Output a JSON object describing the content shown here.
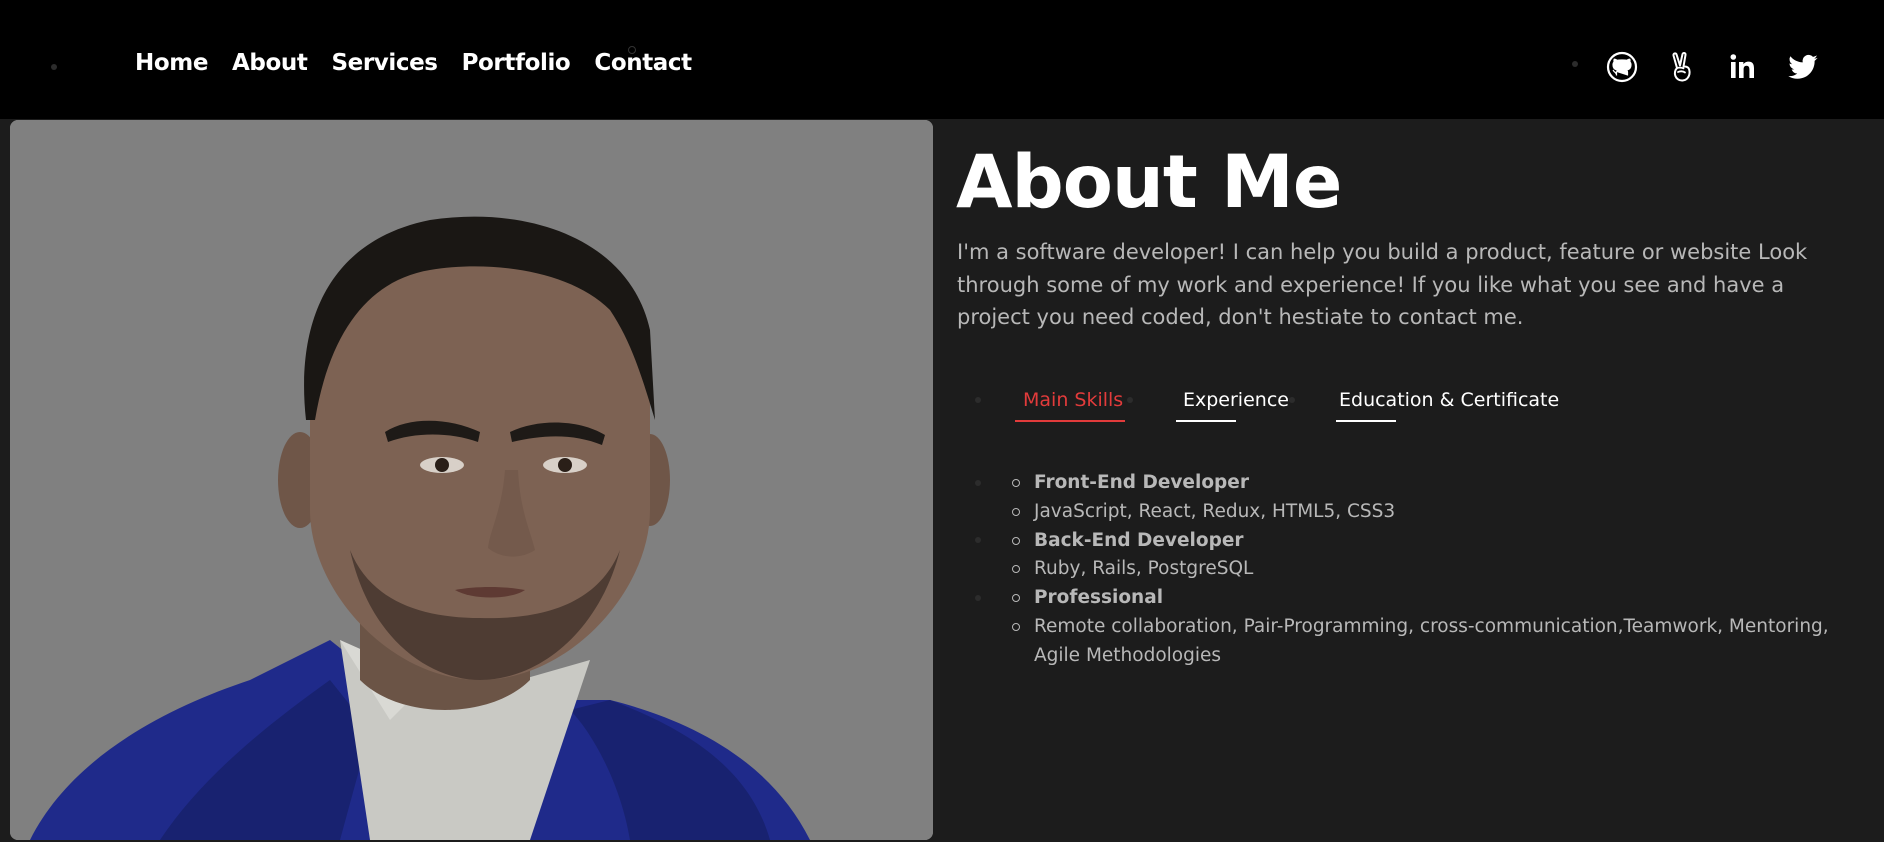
{
  "nav": {
    "links": [
      "Home",
      "About",
      "Services",
      "Portfolio",
      "Contact"
    ]
  },
  "social": [
    {
      "icon": "github-icon"
    },
    {
      "icon": "peace-hand-icon"
    },
    {
      "icon": "linkedin-icon"
    },
    {
      "icon": "twitter-icon"
    }
  ],
  "about": {
    "title": "About Me",
    "description": "I'm a software developer! I can help you build a product, feature or website Look through some of my work and experience! If you like what you see and have a project you need coded, don't hestiate to contact me."
  },
  "tabs": [
    {
      "label": "Main Skills",
      "active": true
    },
    {
      "label": "Experience",
      "active": false
    },
    {
      "label": "Education & Certificate",
      "active": false
    }
  ],
  "skills": [
    {
      "title": "Front-End Developer",
      "detail": "JavaScript, React, Redux, HTML5, CSS3"
    },
    {
      "title": "Back-End Developer",
      "detail": "Ruby, Rails, PostgreSQL"
    },
    {
      "title": "Professional",
      "detail": "Remote collaboration, Pair-Programming, cross-communication,Teamwork, Mentoring, Agile Methodologies"
    }
  ],
  "colors": {
    "accent": "#e23b3b",
    "header_bg": "#000000",
    "page_bg": "#1c1c1c",
    "photo_bg": "#808080"
  }
}
